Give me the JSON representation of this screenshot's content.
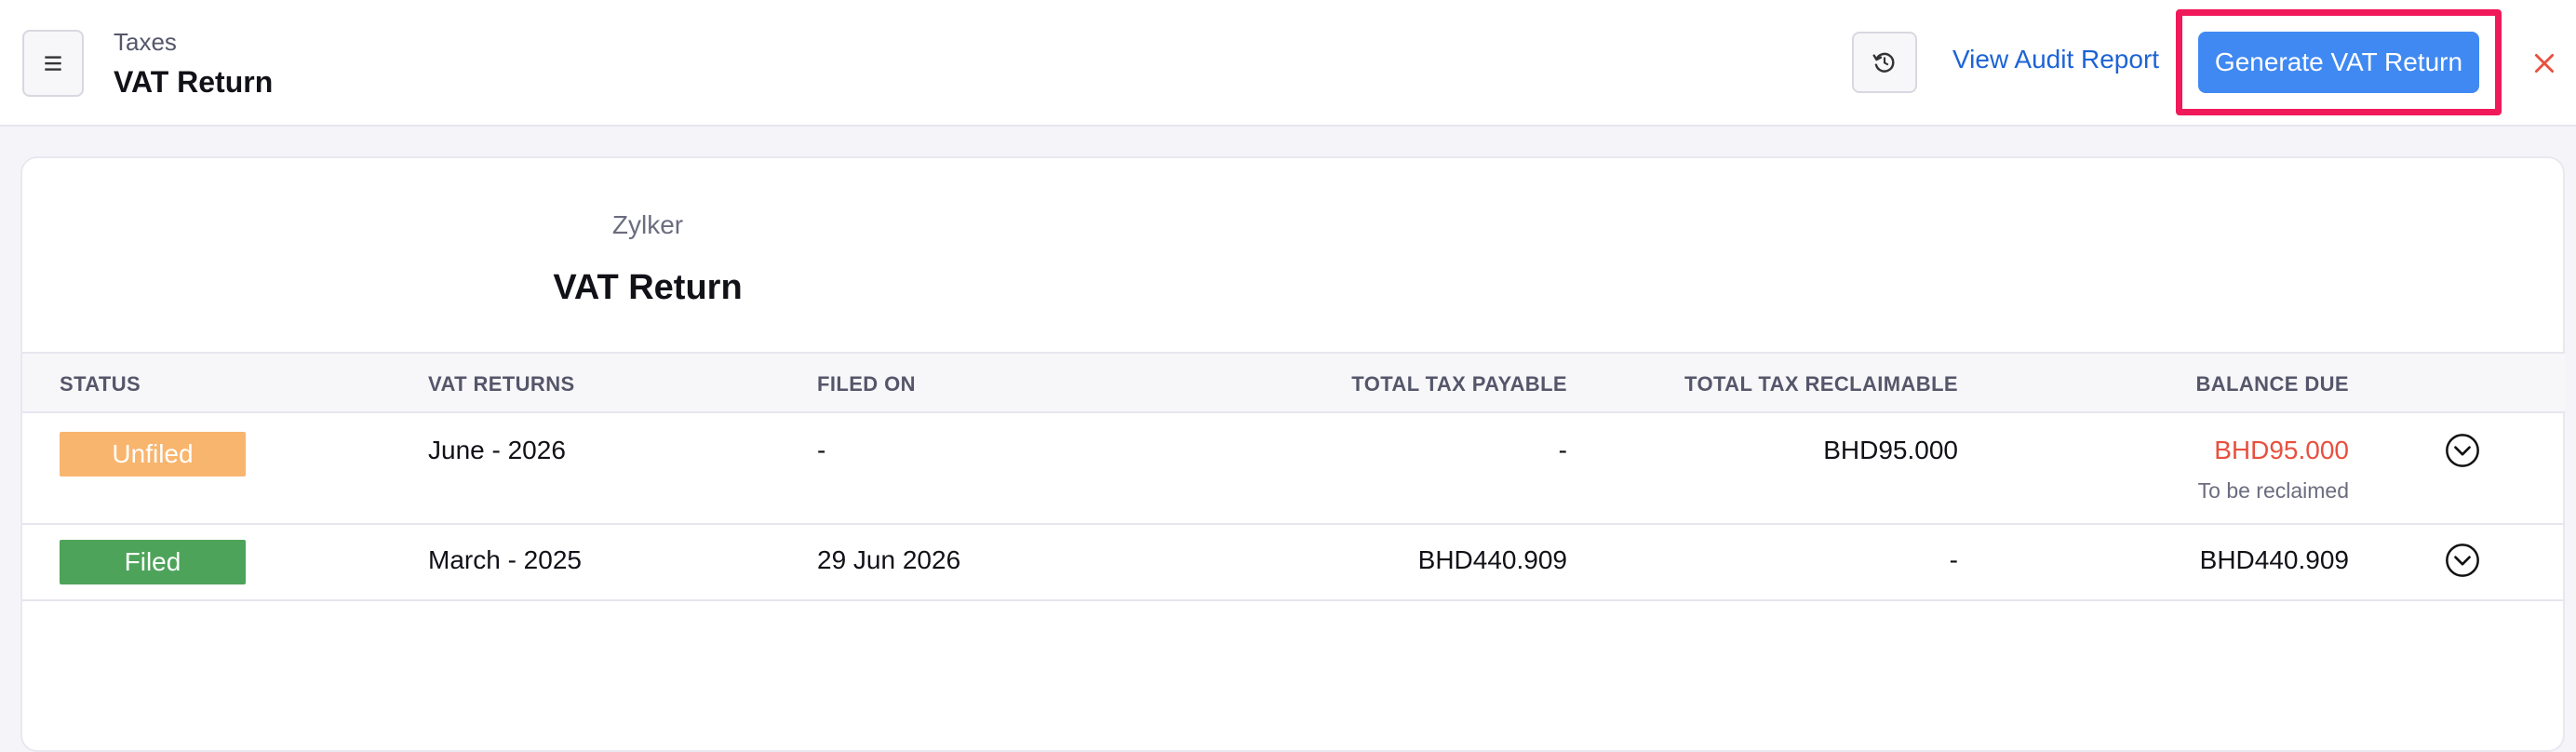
{
  "header": {
    "breadcrumb": "Taxes",
    "title": "VAT Return",
    "audit_link": "View Audit Report",
    "generate_button": "Generate VAT Return",
    "icons": {
      "menu": "hamburger-menu-icon",
      "refresh": "refresh-icon",
      "close": "close-icon"
    },
    "colors": {
      "primary_button": "#4089f2",
      "link": "#1d63d6",
      "close": "#e8503f",
      "highlight": "#f0195a"
    }
  },
  "report": {
    "organization": "Zylker",
    "title": "VAT Return"
  },
  "table": {
    "columns": [
      "STATUS",
      "VAT RETURNS",
      "FILED ON",
      "TOTAL TAX PAYABLE",
      "TOTAL TAX RECLAIMABLE",
      "BALANCE DUE"
    ],
    "rows": [
      {
        "status": "Unfiled",
        "status_color": "#f8b56e",
        "period": "June - 2026",
        "filed_on": "-",
        "total_payable": "-",
        "total_reclaimable": "BHD95.000",
        "balance_due": "BHD95.000",
        "balance_color": "#e8503f",
        "balance_note": "To be reclaimed"
      },
      {
        "status": "Filed",
        "status_color": "#4ea35a",
        "period": "March - 2025",
        "filed_on": "29 Jun 2026",
        "total_payable": "BHD440.909",
        "total_reclaimable": "-",
        "balance_due": "BHD440.909"
      }
    ]
  }
}
